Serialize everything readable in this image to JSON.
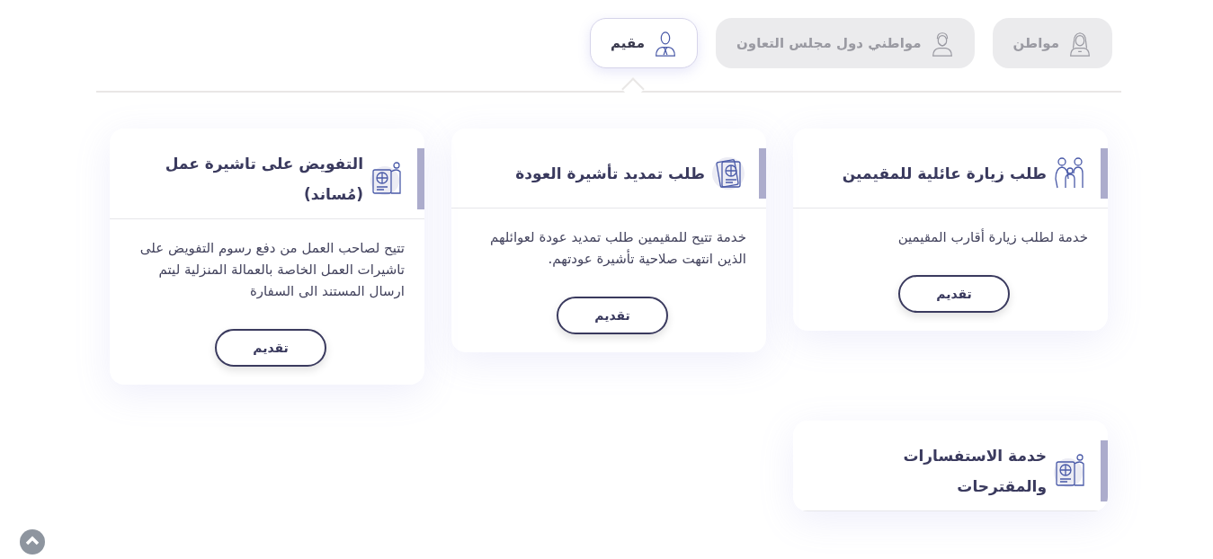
{
  "tabs": [
    {
      "label": "مواطن",
      "kind": "citizen",
      "selected": false
    },
    {
      "label": "مواطني دول مجلس التعاون",
      "kind": "gulf",
      "selected": false
    },
    {
      "label": "مقيم",
      "kind": "resident",
      "selected": true
    }
  ],
  "services": [
    {
      "title": "طلب زيارة عائلية للمقيمين",
      "kind": "family",
      "description": "خدمة لطلب زيارة أقارب المقيمين",
      "button": "تقديم"
    },
    {
      "title": "طلب تمديد تأشيرة العودة",
      "kind": "passport",
      "description": "خدمة تتيح للمقيمين طلب تمديد عودة لعوائلهم الذين انتهت صلاحية تأشيرة عودتهم.",
      "button": "تقديم"
    },
    {
      "title": "التفويض على تاشيرة عمل (مُساند)",
      "kind": "passport-person",
      "description": "تتيح لصاحب العمل من دفع رسوم التفويض على تاشيرات العمل الخاصة بالعمالة المنزلية ليتم ارسال المستند الى السفارة",
      "button": "تقديم"
    },
    {
      "title": "خدمة الاستفسارات والمقترحات",
      "kind": "passport-person"
    }
  ]
}
